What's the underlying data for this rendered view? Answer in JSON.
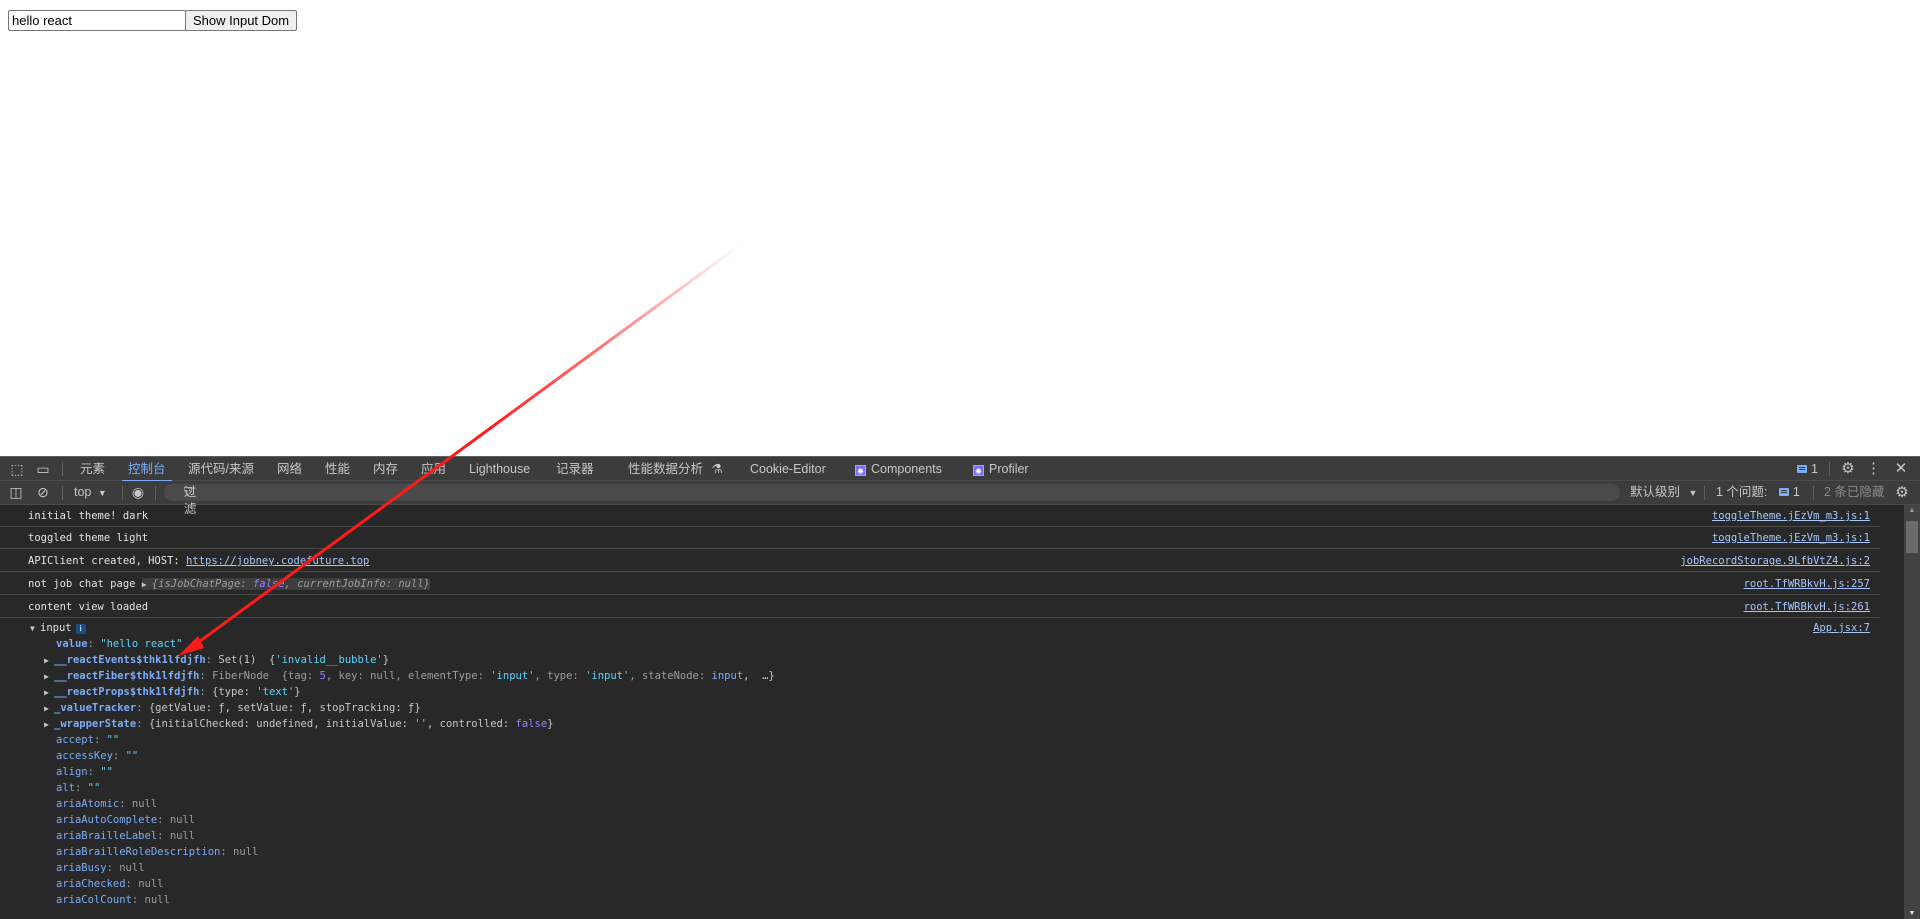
{
  "page": {
    "input_value": "hello react",
    "button_label": "Show Input Dom"
  },
  "devtools": {
    "tabs": [
      {
        "label": "元素",
        "active": false
      },
      {
        "label": "控制台",
        "active": true
      },
      {
        "label": "源代码/来源",
        "active": false
      },
      {
        "label": "网络",
        "active": false
      },
      {
        "label": "性能",
        "active": false
      },
      {
        "label": "内存",
        "active": false
      },
      {
        "label": "应用",
        "active": false
      },
      {
        "label": "Lighthouse",
        "active": false
      },
      {
        "label": "记录器",
        "active": false
      },
      {
        "label": "性能数据分析",
        "active": false
      },
      {
        "label": "Cookie-Editor",
        "active": false
      },
      {
        "label": "Components",
        "active": false
      },
      {
        "label": "Profiler",
        "active": false
      }
    ],
    "flask_icon": "⚗",
    "issues_badge_count": "1",
    "toolbar": {
      "context": "top",
      "filter_placeholder": "过滤",
      "level": "默认级别",
      "issues_label": "1 个问题:",
      "issues_count": "1",
      "hidden_label": "2 条已隐藏"
    },
    "messages": [
      {
        "text": "initial theme! dark",
        "source": "toggleTheme.jEzVm_m3.js:1"
      },
      {
        "text": "toggled theme light",
        "source": "toggleTheme.jEzVm_m3.js:1"
      },
      {
        "text": "APIClient created, HOST: ",
        "link": "https://jobney.codefuture.top",
        "source": "jobRecordStorage.9LfbVtZ4.js:2"
      },
      {
        "text": "not job chat page ",
        "obj_prefix": "{isJobChatPage: ",
        "obj_false": "false",
        "obj_mid": ", currentJobInfo: ",
        "obj_null": "null",
        "obj_suffix": "}",
        "source": "root.TfWRBkvH.js:257"
      },
      {
        "text": "content view loaded",
        "source": "root.TfWRBkvH.js:261"
      }
    ],
    "input_log": {
      "label": "input",
      "source": "App.jsx:7",
      "value_key": "value",
      "value": "\"hello react\"",
      "expandable": [
        {
          "key": "__reactEvents$thk1lfdjfh",
          "preview": "Set(1)  {",
          "str": "'invalid__bubble'",
          "end": "}"
        },
        {
          "key": "__reactFiber$thk1lfdjfh",
          "preview": "FiberNode  {tag: ",
          "num": "5",
          "rest1": ", key: null, elementType: ",
          "str1": "'input'",
          "rest2": ", type: ",
          "str2": "'input'",
          "rest3": ", stateNode: ",
          "node": "input",
          "end": ",  …}"
        },
        {
          "key": "__reactProps$thk1lfdjfh",
          "preview": "{type: ",
          "str": "'text'",
          "end": "}"
        },
        {
          "key": "_valueTracker",
          "preview": "{getValue: ƒ, setValue: ƒ, stopTracking: ƒ}"
        },
        {
          "key": "_wrapperState",
          "preview": "{initialChecked: undefined, initialValue: ",
          "str": "''",
          "rest": ", controlled: ",
          "kw": "false",
          "end": "}"
        }
      ],
      "props": [
        {
          "key": "accept",
          "value": "\"\"",
          "type": "string"
        },
        {
          "key": "accessKey",
          "value": "\"\"",
          "type": "string"
        },
        {
          "key": "align",
          "value": "\"\"",
          "type": "string"
        },
        {
          "key": "alt",
          "value": "\"\"",
          "type": "string"
        },
        {
          "key": "ariaAtomic",
          "value": "null",
          "type": "null"
        },
        {
          "key": "ariaAutoComplete",
          "value": "null",
          "type": "null"
        },
        {
          "key": "ariaBrailleLabel",
          "value": "null",
          "type": "null"
        },
        {
          "key": "ariaBrailleRoleDescription",
          "value": "null",
          "type": "null"
        },
        {
          "key": "ariaBusy",
          "value": "null",
          "type": "null"
        },
        {
          "key": "ariaChecked",
          "value": "null",
          "type": "null"
        },
        {
          "key": "ariaColCount",
          "value": "null",
          "type": "null"
        }
      ]
    }
  },
  "annotation": {
    "color": "#ff1a1a"
  }
}
